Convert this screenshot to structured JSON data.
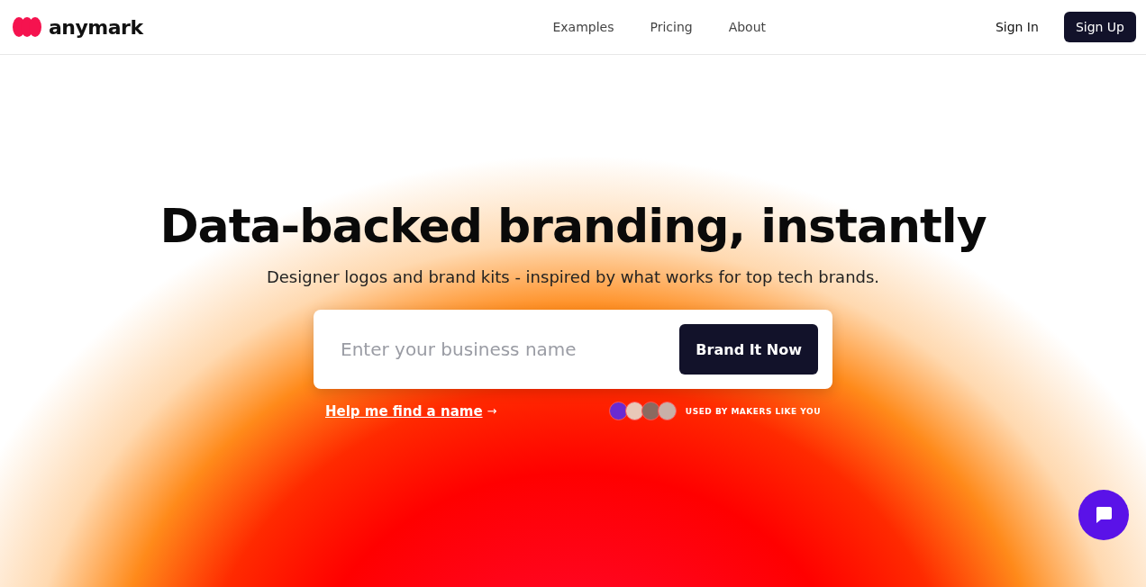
{
  "brand": {
    "name": "anymark"
  },
  "nav": {
    "links": [
      {
        "label": "Examples"
      },
      {
        "label": "Pricing"
      },
      {
        "label": "About"
      }
    ],
    "sign_in": "Sign In",
    "sign_up": "Sign Up"
  },
  "hero": {
    "title": "Data-backed branding, instantly",
    "subtitle": "Designer logos and brand kits - inspired by what works for top tech brands.",
    "search": {
      "placeholder": "Enter your business name",
      "button": "Brand It Now"
    },
    "help_link": "Help me find a name",
    "help_arrow": "→",
    "avatars": [
      {
        "color": "#6a2bd1"
      },
      {
        "color": "#e8c8b8"
      },
      {
        "color": "#8a6a60"
      },
      {
        "color": "#c8b0a8"
      }
    ],
    "social_proof": "USED BY MAKERS LIKE YOU"
  }
}
